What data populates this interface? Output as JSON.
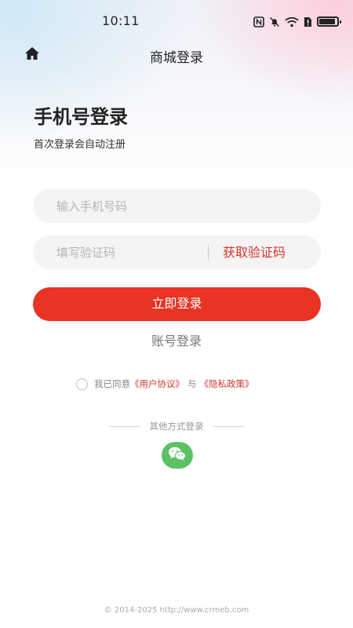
{
  "status_bar": {
    "time": "10:11",
    "icons": [
      "nfc-icon",
      "mute-icon",
      "wifi-icon",
      "sim-alert-icon",
      "battery-icon"
    ]
  },
  "nav": {
    "title": "商城登录",
    "home_icon": "home-icon"
  },
  "heading": {
    "title": "手机号登录",
    "subtitle": "首次登录会自动注册"
  },
  "form": {
    "phone_placeholder": "输入手机号码",
    "phone_value": "",
    "code_placeholder": "填写验证码",
    "code_value": "",
    "get_code_label": "获取验证码",
    "login_label": "立即登录",
    "account_login_label": "账号登录"
  },
  "agreement": {
    "prefix": "我已同意",
    "user_agreement": "《用户协议》",
    "joiner": "与",
    "privacy_policy": "《隐私政策》",
    "checked": false
  },
  "other_login": {
    "label": "其他方式登录",
    "wechat_icon": "wechat-icon"
  },
  "footer": {
    "copyright": "© 2014-2025 http://www.crmeb.com"
  },
  "colors": {
    "accent": "#e93323",
    "link": "#d7352a",
    "wechat": "#5cc164",
    "input_bg": "#f4f4f5"
  }
}
